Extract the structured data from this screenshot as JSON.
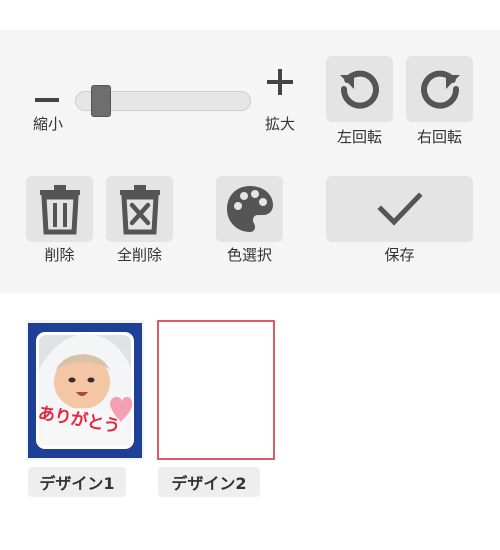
{
  "toolbar": {
    "zoom_out_label": "縮小",
    "zoom_in_label": "拡大",
    "zoom_level": 0.1,
    "rotate_left_label": "左回転",
    "rotate_right_label": "右回転",
    "delete_label": "削除",
    "delete_all_label": "全削除",
    "color_select_label": "色選択",
    "save_label": "保存"
  },
  "designs": [
    {
      "label": "デザイン1",
      "photo_caption": "ありがとう",
      "frame_color": "#1e3f96"
    },
    {
      "label": "デザイン2",
      "frame_color": "#e05a66"
    }
  ],
  "colors": {
    "toolbar_bg": "#f5f5f5",
    "button_bg": "#e4e4e4",
    "icon": "#555555",
    "caption": "#e8263f",
    "heart": "#f3a0b4"
  }
}
